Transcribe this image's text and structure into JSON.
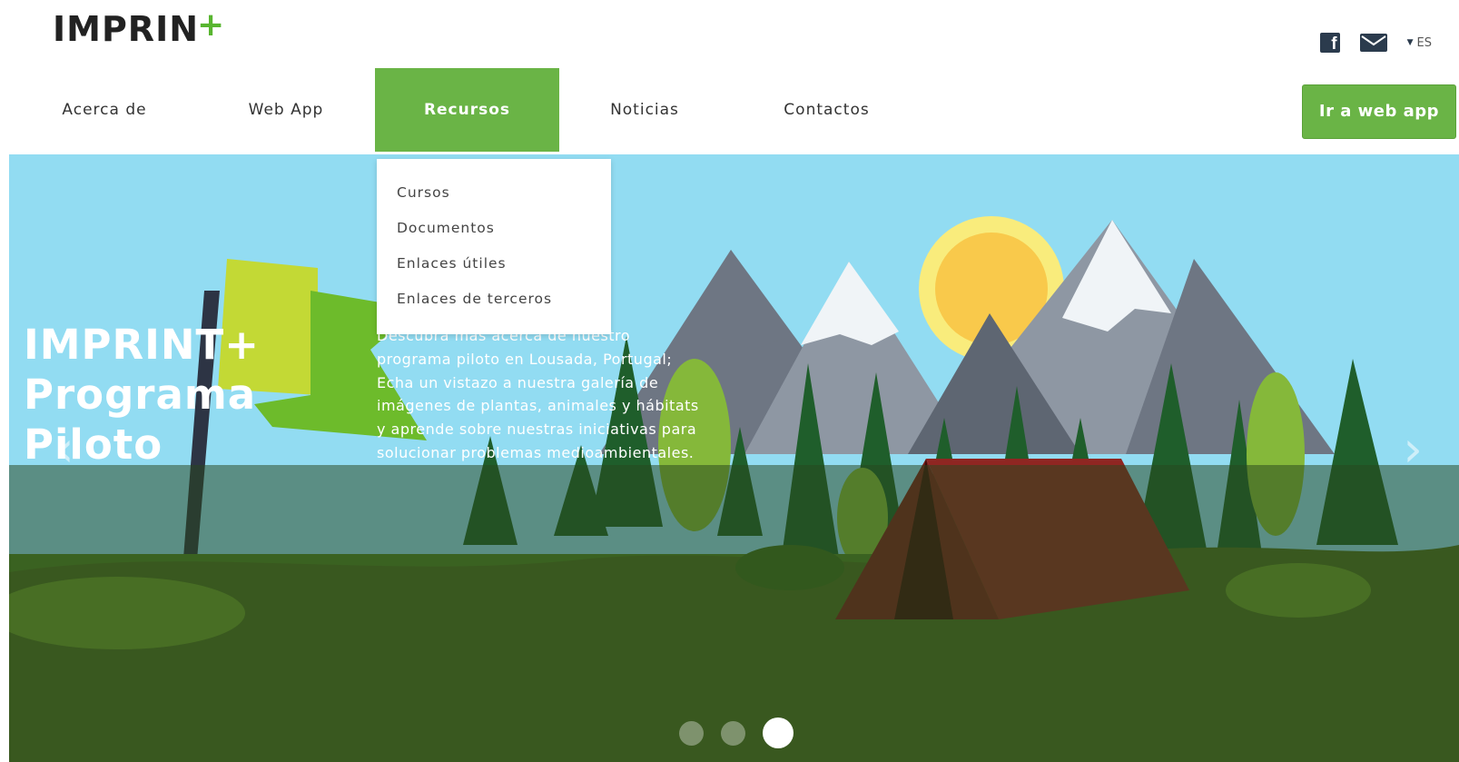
{
  "brand": {
    "logo_text": "IMPRIN",
    "logo_accent": "+",
    "accent_color": "#6ab446"
  },
  "header": {
    "facebook_icon": "facebook-icon",
    "mail_icon": "envelope-icon",
    "language": "ES"
  },
  "nav": {
    "items": [
      {
        "label": "Acerca de"
      },
      {
        "label": "Web App"
      },
      {
        "label": "Recursos",
        "active": true
      },
      {
        "label": "Noticias"
      },
      {
        "label": "Contactos"
      }
    ],
    "cta_label": "Ir a web app"
  },
  "dropdown": {
    "items": [
      {
        "label": "Cursos"
      },
      {
        "label": "Documentos"
      },
      {
        "label": "Enlaces útiles"
      },
      {
        "label": "Enlaces de terceros"
      }
    ]
  },
  "hero": {
    "title_line1": "IMPRINT+",
    "title_line2": "Programa",
    "title_line3": "Piloto",
    "description": "Descubra más acerca de nuestro programa piloto en Lousada, Portugal; Echa un vistazo a nuestra galería de imágenes de plantas, animales y hábitats y aprende sobre nuestras iniciativas para solucionar problemas medioambientales.",
    "prev_arrow": "‹",
    "next_arrow": "›",
    "slides_count": 3,
    "active_slide": 3
  }
}
